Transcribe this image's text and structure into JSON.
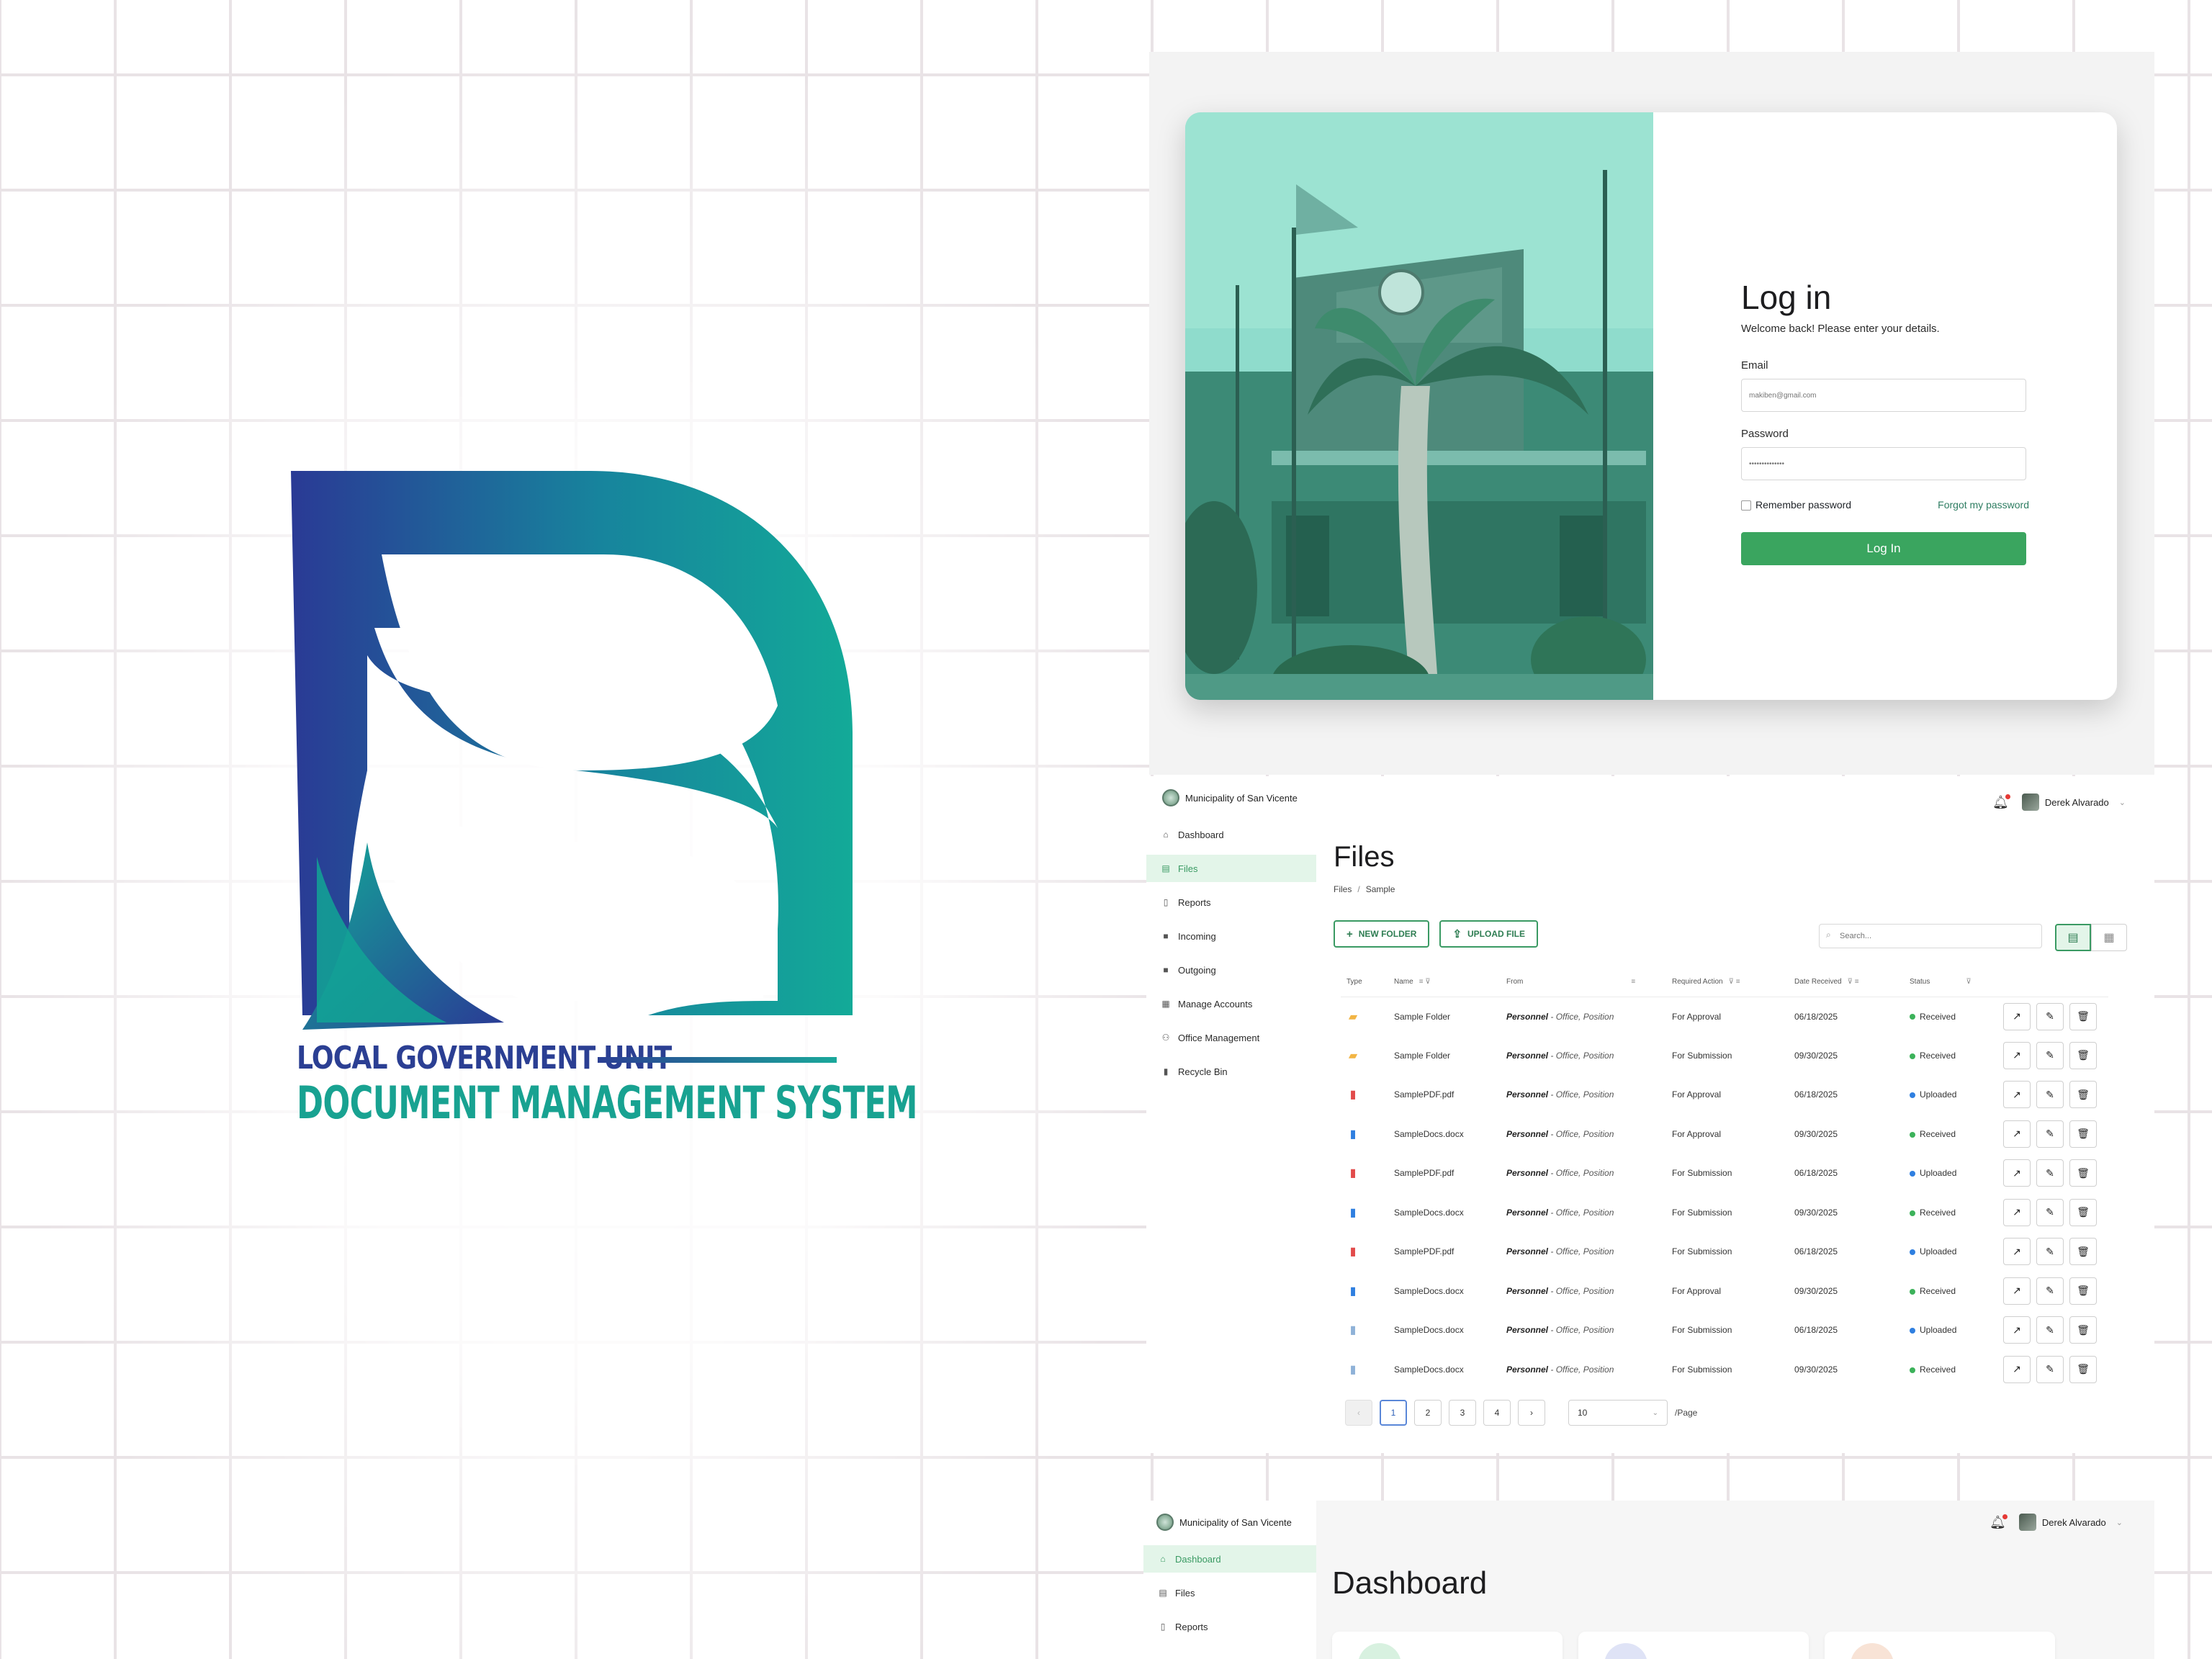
{
  "logo": {
    "line1": "LOCAL GOVERNMENT UNIT",
    "line2": "DOCUMENT MANAGEMENT SYSTEM",
    "colors": {
      "navy": "#2b3f93",
      "teal": "#18a291"
    }
  },
  "login": {
    "title": "Log in",
    "subtitle": "Welcome back! Please enter your details.",
    "email_label": "Email",
    "email_placeholder": "makiben@gmail.com",
    "password_label": "Password",
    "password_value": "••••••••••••••",
    "remember_label": "Remember password",
    "forgot_label": "Forgot my password",
    "submit_label": "Log In",
    "accent": "#3aa55f"
  },
  "app": {
    "org_name": "Municipality of San Vicente",
    "user_name": "Derek Alvarado",
    "nav": [
      {
        "label": "Dashboard",
        "icon": "home-icon"
      },
      {
        "label": "Files",
        "icon": "file-icon",
        "active": true
      },
      {
        "label": "Reports",
        "icon": "report-icon"
      },
      {
        "label": "Incoming",
        "icon": "folder-icon"
      },
      {
        "label": "Outgoing",
        "icon": "folder-icon"
      },
      {
        "label": "Manage Accounts",
        "icon": "accounts-icon"
      },
      {
        "label": "Office Management",
        "icon": "people-icon"
      },
      {
        "label": "Recycle Bin",
        "icon": "trash-icon"
      }
    ]
  },
  "files": {
    "title": "Files",
    "breadcrumb": [
      "Files",
      "Sample"
    ],
    "new_folder_label": "NEW FOLDER",
    "upload_label": "UPLOAD FILE",
    "search_placeholder": "Search...",
    "columns": [
      "Type",
      "Name",
      "From",
      "Required Action",
      "Date Received",
      "Status"
    ],
    "rows": [
      {
        "type": "folder",
        "name": "Sample Folder",
        "from_name": "Personnel",
        "from_detail": " - Office, Position",
        "action": "For Approval",
        "date": "06/18/2025",
        "status": "Received"
      },
      {
        "type": "folder",
        "name": "Sample Folder",
        "from_name": "Personnel",
        "from_detail": " - Office, Position",
        "action": "For Submission",
        "date": "09/30/2025",
        "status": "Received"
      },
      {
        "type": "pdf",
        "name": "SamplePDF.pdf",
        "from_name": "Personnel",
        "from_detail": " - Office, Position",
        "action": "For Approval",
        "date": "06/18/2025",
        "status": "Uploaded"
      },
      {
        "type": "docx",
        "name": "SampleDocs.docx",
        "from_name": "Personnel",
        "from_detail": " - Office, Position",
        "action": "For Approval",
        "date": "09/30/2025",
        "status": "Received"
      },
      {
        "type": "pdf",
        "name": "SamplePDF.pdf",
        "from_name": "Personnel",
        "from_detail": " - Office, Position",
        "action": "For Submission",
        "date": "06/18/2025",
        "status": "Uploaded"
      },
      {
        "type": "docx",
        "name": "SampleDocs.docx",
        "from_name": "Personnel",
        "from_detail": " - Office, Position",
        "action": "For Submission",
        "date": "09/30/2025",
        "status": "Received"
      },
      {
        "type": "pdf",
        "name": "SamplePDF.pdf",
        "from_name": "Personnel",
        "from_detail": " - Office, Position",
        "action": "For Submission",
        "date": "06/18/2025",
        "status": "Uploaded"
      },
      {
        "type": "docx",
        "name": "SampleDocs.docx",
        "from_name": "Personnel",
        "from_detail": " - Office, Position",
        "action": "For Approval",
        "date": "09/30/2025",
        "status": "Received"
      },
      {
        "type": "doc",
        "name": "SampleDocs.docx",
        "from_name": "Personnel",
        "from_detail": " - Office, Position",
        "action": "For Submission",
        "date": "06/18/2025",
        "status": "Uploaded"
      },
      {
        "type": "doc",
        "name": "SampleDocs.docx",
        "from_name": "Personnel",
        "from_detail": " - Office, Position",
        "action": "For Submission",
        "date": "09/30/2025",
        "status": "Received"
      }
    ],
    "pagination": {
      "prev": "‹",
      "next": "›",
      "pages": [
        "1",
        "2",
        "3",
        "4"
      ],
      "current": "1",
      "per_page": "10",
      "per_page_label": "/Page"
    },
    "status_colors": {
      "Received": "#3cb25a",
      "Uploaded": "#2f7fe0"
    }
  },
  "dashboard": {
    "title": "Dashboard",
    "nav": [
      {
        "label": "Dashboard",
        "icon": "home-icon",
        "active": true
      },
      {
        "label": "Files",
        "icon": "file-icon"
      },
      {
        "label": "Reports",
        "icon": "report-icon"
      }
    ]
  }
}
